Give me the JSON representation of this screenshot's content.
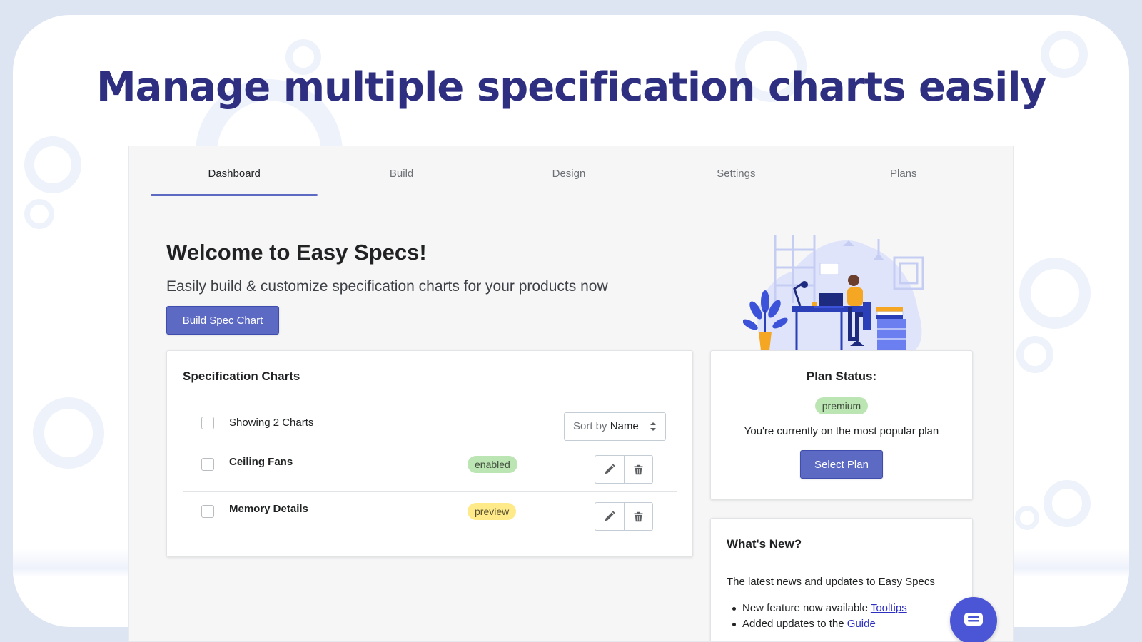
{
  "headline": "Manage multiple specification charts easily",
  "tabs": [
    {
      "label": "Dashboard",
      "active": true
    },
    {
      "label": "Build",
      "active": false
    },
    {
      "label": "Design",
      "active": false
    },
    {
      "label": "Settings",
      "active": false
    },
    {
      "label": "Plans",
      "active": false
    }
  ],
  "welcome": {
    "title": "Welcome to Easy Specs!",
    "subtitle": "Easily build & customize specification charts for your products now",
    "build_button": "Build Spec Chart"
  },
  "spec_charts": {
    "title": "Specification Charts",
    "showing": "Showing 2 Charts",
    "sort_label": "Sort by",
    "sort_value": "Name",
    "rows": [
      {
        "name": "Ceiling Fans",
        "status": "enabled"
      },
      {
        "name": "Memory Details",
        "status": "preview"
      }
    ]
  },
  "plan": {
    "title": "Plan Status:",
    "badge": "premium",
    "text": "You're currently on the most popular plan",
    "button": "Select Plan"
  },
  "news": {
    "title": "What's New?",
    "subtitle": "The latest news and updates to Easy Specs",
    "items": [
      {
        "text": "New feature now available ",
        "link": "Tooltips"
      },
      {
        "text": "Added updates to the ",
        "link": "Guide"
      }
    ]
  },
  "colors": {
    "accent": "#5c6ac4",
    "headline": "#2e2f80",
    "badge_enabled": "#bbe5b3",
    "badge_preview": "#ffea8a",
    "chat": "#4a56d6"
  },
  "icons": [
    "pencil-icon",
    "trash-icon",
    "sort-arrows-icon",
    "chat-icon"
  ]
}
